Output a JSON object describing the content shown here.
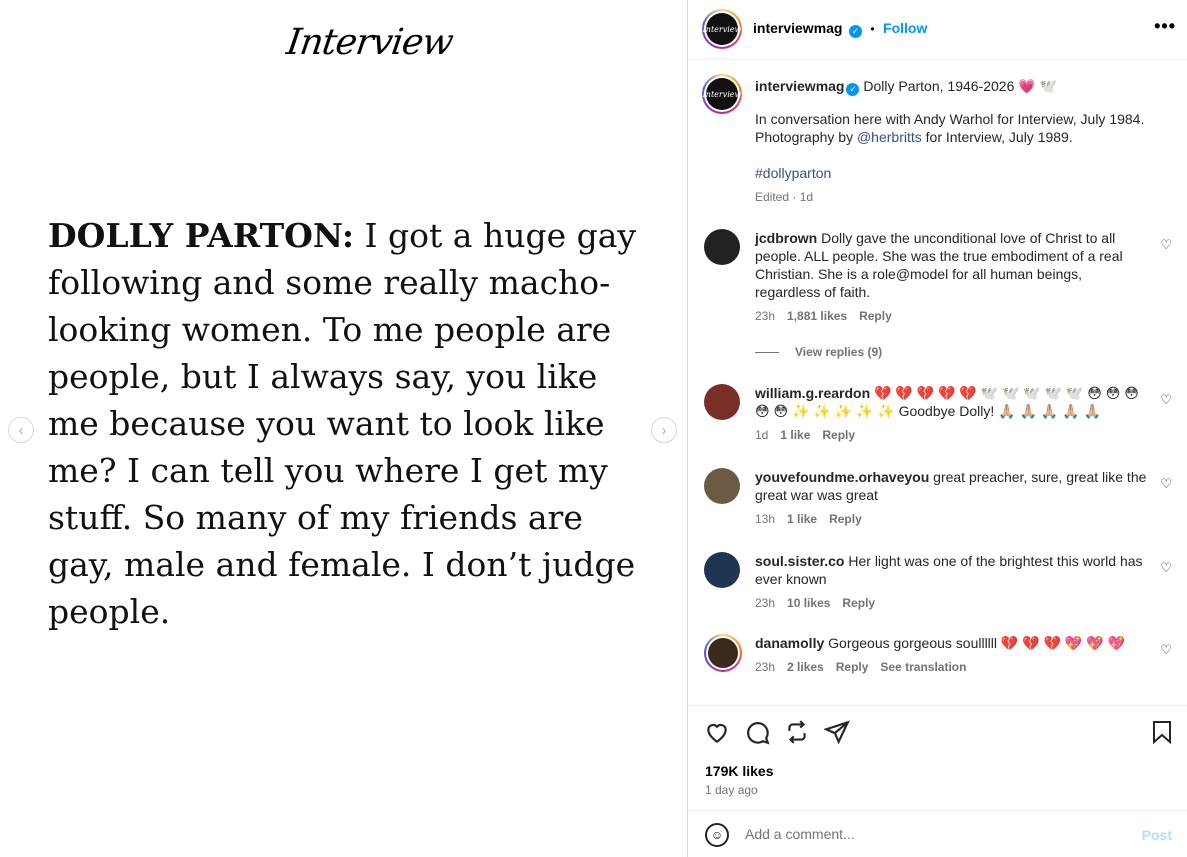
{
  "media": {
    "logo": "Interview",
    "quote_speaker": "DOLLY PARTON:",
    "quote_text": " I got a huge gay following and some really macho-looking women. To me people are people, but I always say, you like me because you want to look like me? I can tell you where I get my stuff. So many of my friends are gay, male and female. I don’t judge people.",
    "prev_icon": "‹",
    "next_icon": "›"
  },
  "header": {
    "username": "interviewmag",
    "dot": "•",
    "follow": "Follow",
    "more": "•••",
    "avatar_text": "Interview"
  },
  "caption": {
    "username": "interviewmag",
    "title": "Dolly Parton, 1946-2026 💗 🕊️",
    "line1": "In conversation here with Andy Warhol for Interview, July 1984.",
    "line2_pre": "Photography by ",
    "line2_mention": "@herbritts",
    "line2_post": " for Interview, July 1989.",
    "hashtag": "#dollyparton",
    "edited": "Edited · 1d"
  },
  "comments": [
    {
      "user": "jcdbrown",
      "text": "Dolly gave the unconditional love of Christ to all people. ALL people. She was the true embodiment of a real Christian. She is a role@model for all human beings, regardless of faith.",
      "time": "23h",
      "likes": "1,881 likes",
      "reply": "Reply",
      "view_replies": "View replies (9)"
    },
    {
      "user": "william.g.reardon",
      "text": "💔 💔 💔 💔 💔 🕊️ 🕊️ 🕊️ 🕊️ 🕊️ 😳 😳 😳 😳 😳 ✨ ✨ ✨ ✨ ✨ Goodbye Dolly! 🙏🏼 🙏🏼 🙏🏼 🙏🏼 🙏🏼",
      "time": "1d",
      "likes": "1 like",
      "reply": "Reply"
    },
    {
      "user": "youvefoundme.orhaveyou",
      "text": "great preacher, sure, great like the great war was great",
      "time": "13h",
      "likes": "1 like",
      "reply": "Reply"
    },
    {
      "user": "soul.sister.co",
      "text": "Her light was one of the brightest this world has ever known",
      "time": "23h",
      "likes": "10 likes",
      "reply": "Reply"
    },
    {
      "user": "danamolly",
      "text": "Gorgeous gorgeous soullllll 💔 💔 💔 💖 💖 💖",
      "time": "23h",
      "likes": "2 likes",
      "reply": "Reply",
      "translation": "See translation"
    }
  ],
  "actions": {
    "like_icon": "heart-icon",
    "comment_icon": "comment-icon",
    "repost_icon": "repost-icon",
    "share_icon": "share-icon",
    "save_icon": "bookmark-icon",
    "likes": "179K likes",
    "ago": "1 day ago"
  },
  "add_comment": {
    "placeholder": "Add a comment...",
    "post": "Post",
    "emoji_icon": "☺"
  },
  "colors": {
    "accent": "#0095f6",
    "muted": "#737373",
    "link": "#385185"
  }
}
